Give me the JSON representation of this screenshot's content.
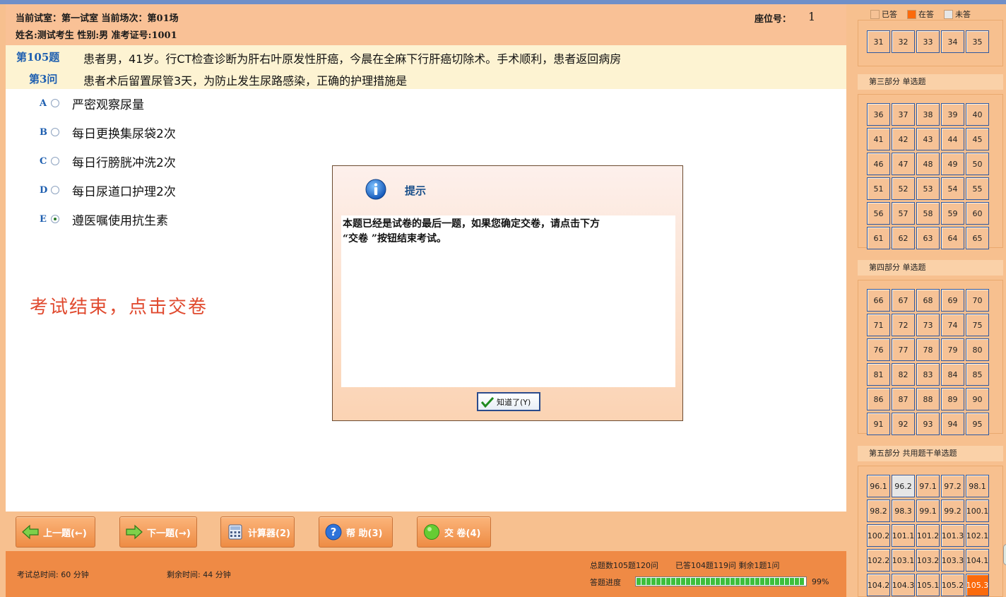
{
  "header": {
    "room_line": "当前试室：第一试室 当前场次：第01场",
    "student_line": "姓名:测试考生   性别:男   准考证号:1001",
    "seat_label": "座位号：",
    "seat_number": "1"
  },
  "question": {
    "number_label": "第105题",
    "sub_label": "第3问",
    "stem": "患者男，41岁。行CT检查诊断为肝右叶原发性肝癌，今晨在全麻下行肝癌切除术。手术顺利，患者返回病房",
    "sub_question": "患者术后留置尿管3天，为防止发生尿路感染，正确的护理措施是",
    "options": [
      {
        "letter": "A",
        "text": "严密观察尿量",
        "selected": false
      },
      {
        "letter": "B",
        "text": "每日更换集尿袋2次",
        "selected": false
      },
      {
        "letter": "C",
        "text": "每日行膀胱冲洗2次",
        "selected": false
      },
      {
        "letter": "D",
        "text": "每日尿道口护理2次",
        "selected": false
      },
      {
        "letter": "E",
        "text": "遵医嘱使用抗生素",
        "selected": true
      }
    ],
    "hint": "考试结束，点击交卷"
  },
  "toolbar": {
    "prev": "上一题(←)",
    "next": "下一题(→)",
    "calc": "计算器(2)",
    "help": "帮  助(3)",
    "submit": "交  卷(4)"
  },
  "footer": {
    "total_time": "考试总时间:  60 分钟",
    "remaining_time": "剩余时间:  44 分钟",
    "total_count": "总题数105题120问",
    "answered_count": "已答104题119问 剩余1题1问",
    "progress_label": "答题进度",
    "progress_percent": "99%",
    "progress_value": 0.99
  },
  "legend": {
    "answered": "已答",
    "current": "在答",
    "unanswered": "未答",
    "colors": {
      "answered": "#f6c296",
      "current": "#fb6a0c",
      "unanswered": "#e6e6e6"
    }
  },
  "sections": [
    {
      "title": "",
      "items": [
        "31",
        "32",
        "33",
        "34",
        "35"
      ]
    },
    {
      "title": "第三部分   单选题",
      "items": [
        "36",
        "37",
        "38",
        "39",
        "40",
        "41",
        "42",
        "43",
        "44",
        "45",
        "46",
        "47",
        "48",
        "49",
        "50",
        "51",
        "52",
        "53",
        "54",
        "55",
        "56",
        "57",
        "58",
        "59",
        "60",
        "61",
        "62",
        "63",
        "64",
        "65"
      ]
    },
    {
      "title": "第四部分   单选题",
      "items": [
        "66",
        "67",
        "68",
        "69",
        "70",
        "71",
        "72",
        "73",
        "74",
        "75",
        "76",
        "77",
        "78",
        "79",
        "80",
        "81",
        "82",
        "83",
        "84",
        "85",
        "86",
        "87",
        "88",
        "89",
        "90",
        "91",
        "92",
        "93",
        "94",
        "95"
      ]
    },
    {
      "title": "第五部分   共用题干单选题",
      "items": [
        "96.1",
        "96.2",
        "97.1",
        "97.2",
        "98.1",
        "98.2",
        "98.3",
        "99.1",
        "99.2",
        "100.1",
        "100.2",
        "101.1",
        "101.2",
        "101.3",
        "102.1",
        "102.2",
        "103.1",
        "103.2",
        "103.3",
        "104.1",
        "104.2",
        "104.3",
        "105.1",
        "105.2",
        "105.3"
      ]
    }
  ],
  "unanswered_items": [
    "96.2"
  ],
  "current_item": "105.3",
  "dialog": {
    "title": "提示",
    "message_line1": "本题已经是试卷的最后一题，如果您确定交卷，请点击下方",
    "message_line2": "“交卷 ”按钮结束考试。",
    "ok_button": "知道了(Y)"
  }
}
